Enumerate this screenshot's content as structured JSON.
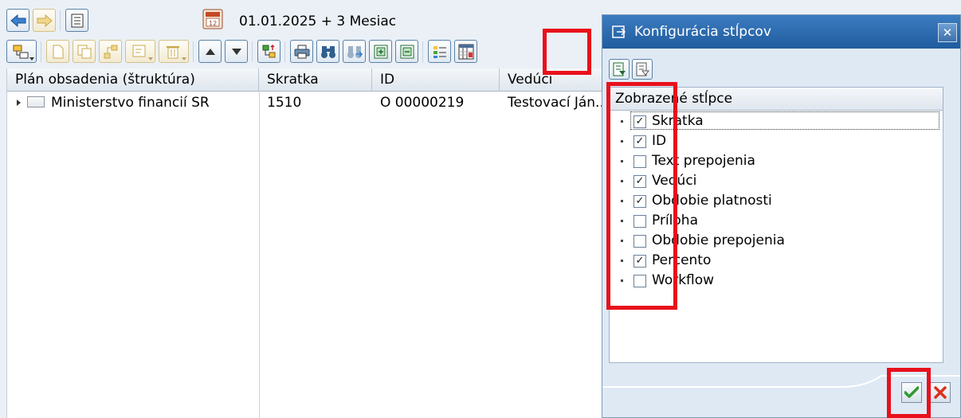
{
  "toolbar": {
    "date_range": "01.01.2025  + 3 Mesiac"
  },
  "table": {
    "columns": [
      {
        "label": "Plán obsadenia (štruktúra)"
      },
      {
        "label": "Skratka"
      },
      {
        "label": "ID"
      },
      {
        "label": "Vedúci"
      }
    ],
    "rows": [
      {
        "name": "Ministerstvo financií SR",
        "skratka": "1510",
        "id": "O  00000219",
        "veduci": "Testovací Ján..."
      }
    ]
  },
  "dialog": {
    "title": "Konfigurácia stĺpcov",
    "list_header": "Zobrazené stĺpce",
    "items": [
      {
        "label": "Skratka",
        "checked": true
      },
      {
        "label": "ID",
        "checked": true
      },
      {
        "label": "Text prepojenia",
        "checked": false
      },
      {
        "label": "Vedúci",
        "checked": true
      },
      {
        "label": "Obdobie platnosti",
        "checked": true
      },
      {
        "label": "Príloha",
        "checked": false
      },
      {
        "label": "Obdobie prepojenia",
        "checked": false
      },
      {
        "label": "Percento",
        "checked": true
      },
      {
        "label": "Workflow",
        "checked": false
      }
    ]
  },
  "colors": {
    "highlight": "#e8101b",
    "title_bar": "#2a68ad",
    "confirm": "#2e9a2e",
    "cancel": "#d9301c"
  }
}
